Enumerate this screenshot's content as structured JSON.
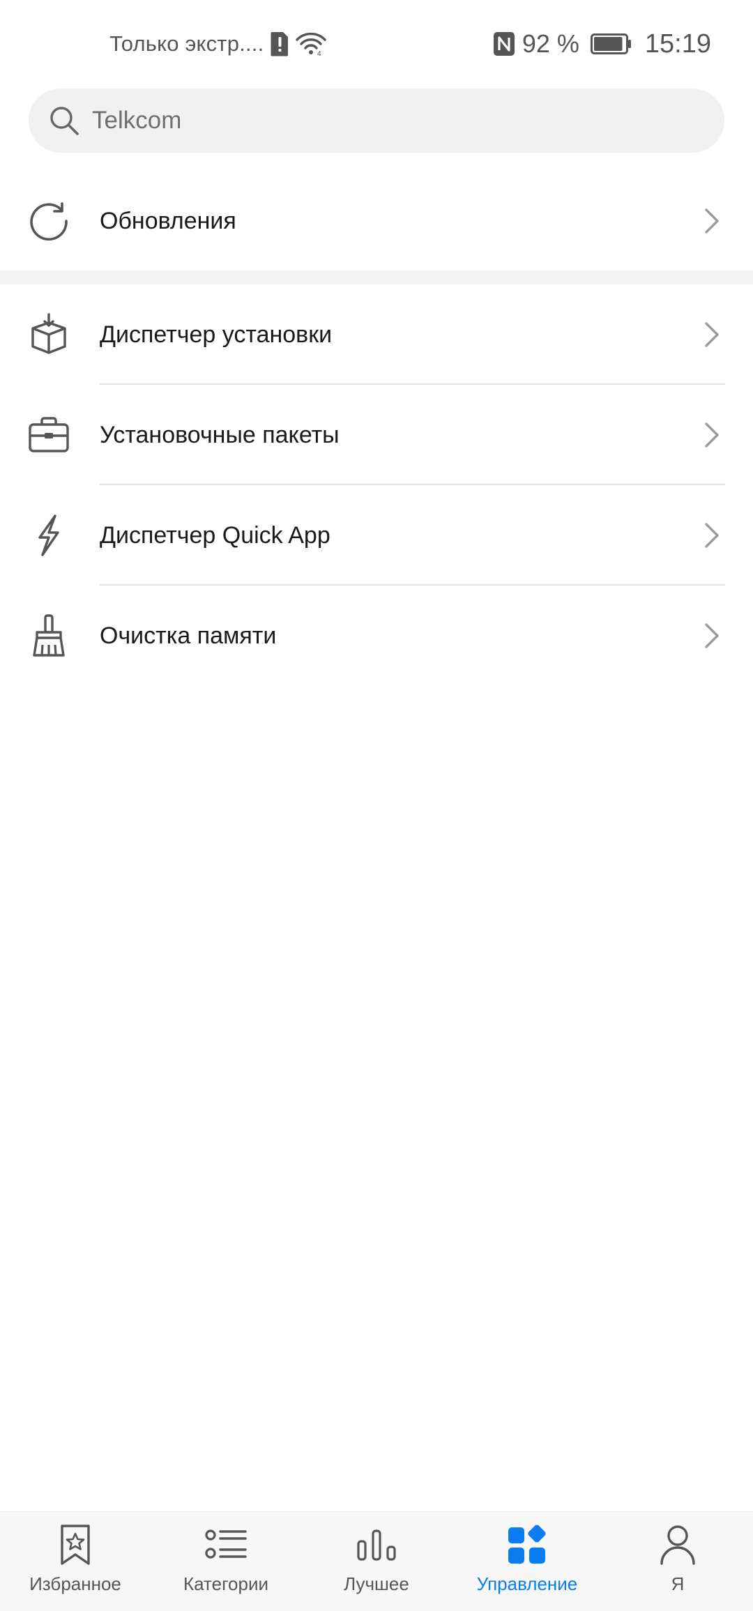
{
  "status_bar": {
    "carrier": "Только экстр....",
    "battery_percent": "92 %",
    "battery_level": 0.92,
    "time": "15:19",
    "icons": [
      "sim-alert-icon",
      "wifi-icon",
      "nfc-icon",
      "battery-icon"
    ]
  },
  "search": {
    "placeholder": "Telkcom",
    "icon": "search-icon"
  },
  "menu": {
    "updates": {
      "label": "Обновления",
      "icon": "refresh-icon"
    },
    "items": [
      {
        "label": "Диспетчер установки",
        "icon": "install-box-icon"
      },
      {
        "label": "Установочные пакеты",
        "icon": "briefcase-icon"
      },
      {
        "label": "Диспетчер Quick App",
        "icon": "lightning-icon"
      },
      {
        "label": "Очистка памяти",
        "icon": "broom-icon"
      }
    ]
  },
  "bottom_nav": {
    "active_index": 3,
    "accent_color": "#0a7cf0",
    "items": [
      {
        "label": "Избранное",
        "icon": "bookmark-star-icon"
      },
      {
        "label": "Категории",
        "icon": "list-icon"
      },
      {
        "label": "Лучшее",
        "icon": "bars-chart-icon"
      },
      {
        "label": "Управление",
        "icon": "apps-grid-icon"
      },
      {
        "label": "Я",
        "icon": "person-icon"
      }
    ]
  }
}
